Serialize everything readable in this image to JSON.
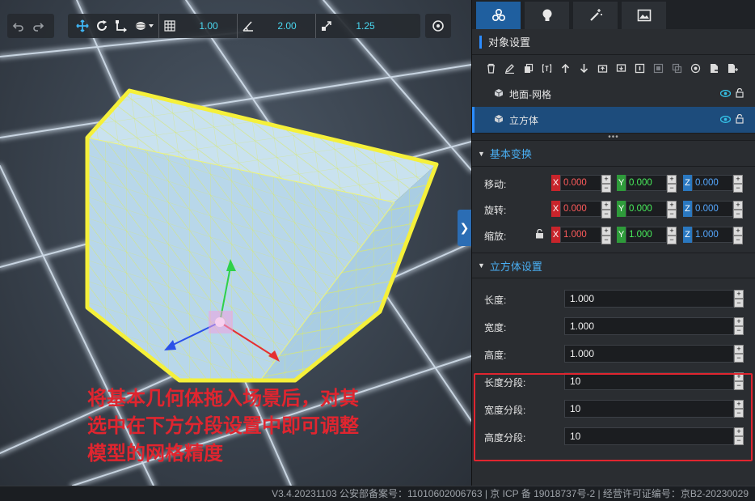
{
  "toolbar": {
    "grid_snap_value": "1.00",
    "angle_snap_value": "2.00",
    "scale_snap_value": "1.25"
  },
  "caption": {
    "line1": "将基本几何体拖入场景后，对其",
    "line2": "选中在下方分段设置中即可调整",
    "line3": "模型的网格精度"
  },
  "panel": {
    "section_title": "对象设置",
    "objects": [
      {
        "label": "地面-网格",
        "selected": false
      },
      {
        "label": "立方体",
        "selected": true
      }
    ],
    "transform": {
      "header": "基本变换",
      "rows": [
        {
          "label": "移动:",
          "x": "0.000",
          "y": "0.000",
          "z": "0.000"
        },
        {
          "label": "旋转:",
          "x": "0.000",
          "y": "0.000",
          "z": "0.000"
        },
        {
          "label": "缩放:",
          "x": "1.000",
          "y": "1.000",
          "z": "1.000"
        }
      ],
      "axis_labels": {
        "x": "X",
        "y": "Y",
        "z": "Z"
      }
    },
    "cube_settings": {
      "header": "立方体设置",
      "rows": [
        {
          "label": "长度:",
          "value": "1.000"
        },
        {
          "label": "宽度:",
          "value": "1.000"
        },
        {
          "label": "高度:",
          "value": "1.000"
        },
        {
          "label": "长度分段:",
          "value": "10"
        },
        {
          "label": "宽度分段:",
          "value": "10"
        },
        {
          "label": "高度分段:",
          "value": "10"
        }
      ]
    }
  },
  "footer": {
    "text": "V3.4.20231103 公安部备案号：11010602006763 | 京 ICP 备 19018737号-2 | 经营许可证编号：京B2-20230029"
  },
  "colors": {
    "accent": "#2b8cff",
    "selection_outline": "#f5f03a",
    "caption": "#e0252f"
  }
}
